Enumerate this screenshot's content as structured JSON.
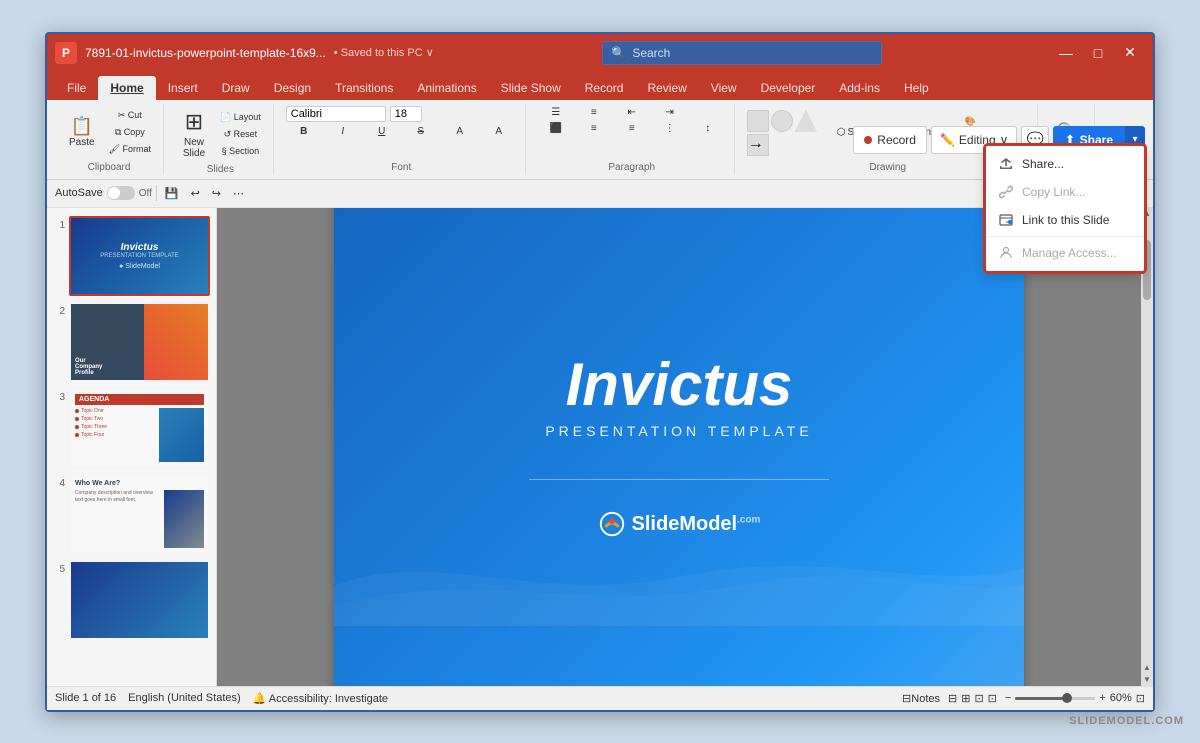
{
  "window": {
    "title": "7891-01-invictus-powerpoint-template-16x9...",
    "saved_status": "• Saved to this PC ∨",
    "logo_text": "P"
  },
  "search": {
    "placeholder": "Search",
    "icon": "🔍"
  },
  "title_controls": {
    "minimize": "—",
    "restore": "□",
    "close": "✕"
  },
  "ribbon": {
    "tabs": [
      "File",
      "Home",
      "Insert",
      "Draw",
      "Design",
      "Transitions",
      "Animations",
      "Slide Show",
      "Record",
      "Review",
      "View",
      "Developer",
      "Add-ins",
      "Help"
    ],
    "active_tab": "Home",
    "groups": {
      "clipboard": "Clipboard",
      "slides": "Slides",
      "font": "Font",
      "paragraph": "Paragraph",
      "drawing": "Drawing"
    }
  },
  "toolbar": {
    "autosave_label": "AutoSave",
    "save_icon": "💾",
    "undo": "↩",
    "redo": "↪"
  },
  "right_controls": {
    "record_label": "Record",
    "editing_label": "Editing",
    "editing_arrow": "∨",
    "comment_icon": "💬",
    "share_label": "Share",
    "share_icon": "⬆"
  },
  "share_dropdown": {
    "items": [
      {
        "id": "share",
        "label": "Share...",
        "icon": "🔗",
        "disabled": false
      },
      {
        "id": "copy_link",
        "label": "Copy Link...",
        "icon": "🔗",
        "disabled": true
      },
      {
        "id": "link_to_slide",
        "label": "Link to this Slide",
        "icon": "🔗",
        "disabled": false
      },
      {
        "id": "manage_access",
        "label": "Manage Access...",
        "icon": "⚙",
        "disabled": true
      }
    ]
  },
  "slides": [
    {
      "num": "1",
      "type": "invictus_title"
    },
    {
      "num": "2",
      "type": "company_profile"
    },
    {
      "num": "3",
      "type": "agenda"
    },
    {
      "num": "4",
      "type": "who_we_are"
    },
    {
      "num": "5",
      "type": "blue_slide"
    }
  ],
  "main_slide": {
    "title": "Invictus",
    "subtitle": "PRESENTATION TEMPLATE",
    "logo_text": "SlideModel",
    "logo_suffix": ".com"
  },
  "status_bar": {
    "slide_info": "Slide 1 of 16",
    "language": "English (United States)",
    "accessibility": "🔔 Accessibility: Investigate",
    "notes": "⊟Notes",
    "zoom_pct": "60%"
  },
  "watermark": "SLIDEMODEL.COM"
}
